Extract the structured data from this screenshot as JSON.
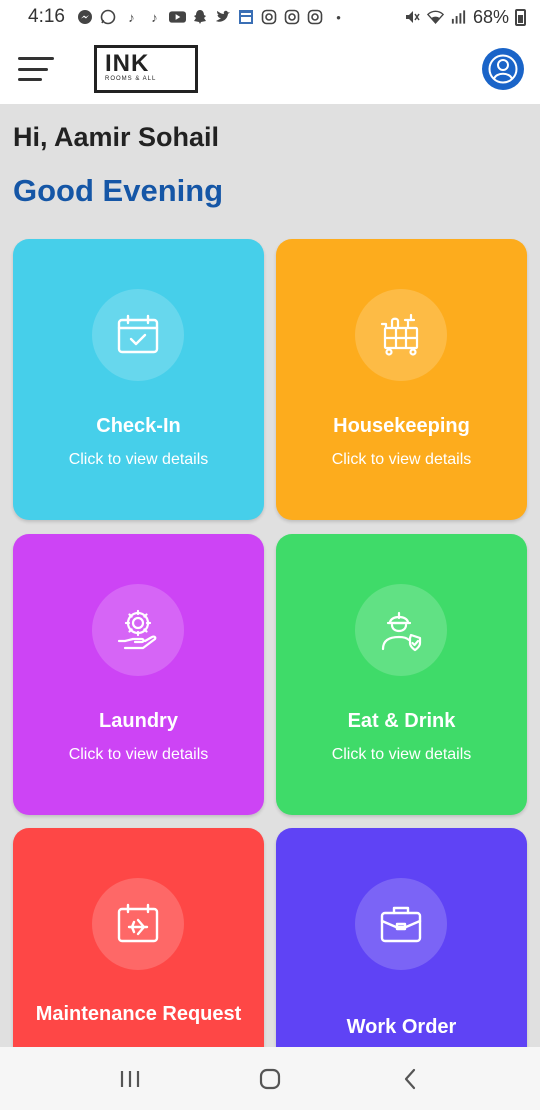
{
  "status_bar": {
    "time": "4:16",
    "battery": "68%",
    "icons": [
      "messenger-icon",
      "whatsapp-icon",
      "tiktok-icon",
      "tiktok-icon",
      "youtube-icon",
      "snapchat-icon",
      "twitter-icon",
      "news-icon",
      "instagram-icon",
      "instagram-icon",
      "instagram-icon",
      "dot-icon",
      "mute-icon",
      "wifi-icon",
      "signal-icon",
      "battery-icon"
    ]
  },
  "header": {
    "logo_text": "INK",
    "logo_sub": "ROOMS & ALL"
  },
  "greeting": {
    "name_line": "Hi, Aamir Sohail",
    "daypart": "Good Evening"
  },
  "cards": [
    {
      "title": "Check-In",
      "subtitle": "Click to view details",
      "color": "#46cfea",
      "icon": "calendar-check-icon"
    },
    {
      "title": "Housekeeping",
      "subtitle": "Click to view details",
      "color": "#fdac1d",
      "icon": "housekeeping-cart-icon"
    },
    {
      "title": "Laundry",
      "subtitle": "Click to view details",
      "color": "#cd44f5",
      "icon": "gear-hand-icon"
    },
    {
      "title": "Eat & Drink",
      "subtitle": "Click to view details",
      "color": "#3fdb69",
      "icon": "worker-icon"
    },
    {
      "title": "Maintenance Request",
      "subtitle": "",
      "color": "#fe4746",
      "icon": "calendar-plane-icon"
    },
    {
      "title": "Work Order",
      "subtitle": "",
      "color": "#5f43f5",
      "icon": "briefcase-icon"
    }
  ],
  "colors": {
    "accent": "#1556a6",
    "avatar": "#1a64c8",
    "background": "#e0e0e0"
  }
}
